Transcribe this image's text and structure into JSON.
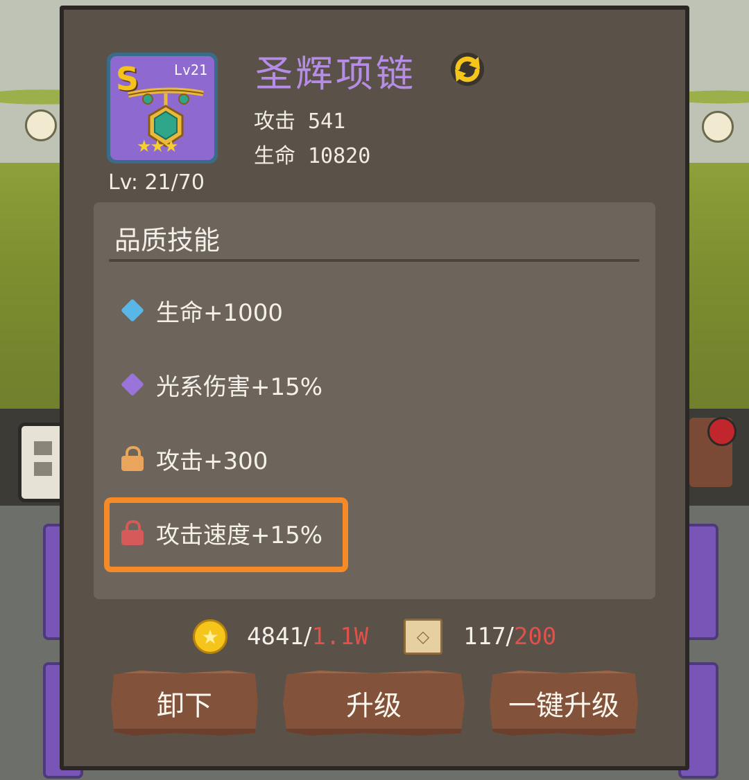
{
  "item": {
    "rank_badge": "S",
    "level_badge": "Lv21",
    "stars": "★★★",
    "name": "圣辉项链",
    "level_text": "Lv: 21/70",
    "stats": [
      {
        "label": "攻击",
        "value": "541"
      },
      {
        "label": "生命",
        "value": "10820"
      }
    ]
  },
  "skills": {
    "title": "品质技能",
    "items": [
      {
        "text": "生命+1000",
        "icon": "diamond-icon",
        "color": "#5ab6e6"
      },
      {
        "text": "光系伤害+15%",
        "icon": "diamond-icon",
        "color": "#9a74d8"
      },
      {
        "text": "攻击+300",
        "icon": "lock-icon",
        "color": "#e8a55b"
      },
      {
        "text": "攻击速度+15%",
        "icon": "lock-icon",
        "color": "#d65a5a"
      }
    ]
  },
  "resources": {
    "gold": {
      "current": "4841",
      "max": "1.1W",
      "icon": "gold-coin-icon"
    },
    "scroll": {
      "current": "117",
      "max": "200",
      "icon": "necklace-scroll-icon"
    }
  },
  "buttons": {
    "unequip": "卸下",
    "upgrade": "升级",
    "one_click_upgrade": "一键升级"
  },
  "colors": {
    "highlight": "#f68a27",
    "title": "#b58de6",
    "panel": "#5a5148",
    "button": "#83523a"
  }
}
